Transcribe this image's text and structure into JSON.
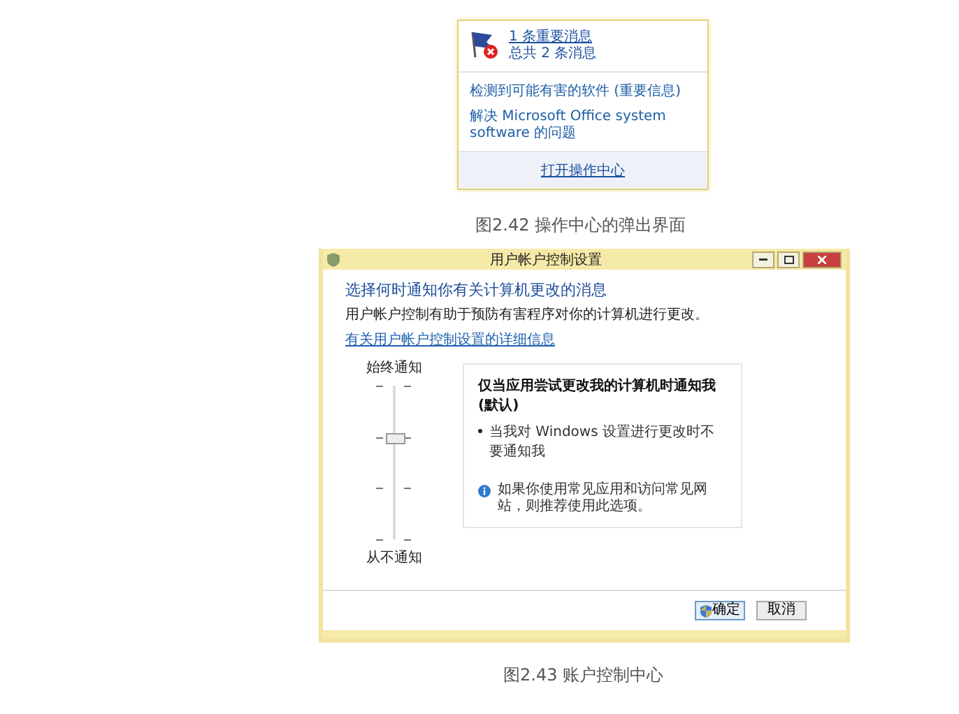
{
  "popup": {
    "header_title": "1 条重要消息",
    "header_subtitle": "总共 2 条消息",
    "links": [
      "检测到可能有害的软件 (重要信息)",
      "解决 Microsoft Office system software 的问题"
    ],
    "footer_link": "打开操作中心"
  },
  "caption_1": "图2.42 操作中心的弹出界面",
  "dialog": {
    "title": "用户帐户控制设置",
    "heading": "选择何时通知你有关计算机更改的消息",
    "description": "用户帐户控制有助于预防有害程序对你的计算机进行更改。",
    "help_link": "有关用户帐户控制设置的详细信息",
    "slider_top_label": "始终通知",
    "slider_bottom_label": "从不通知",
    "slider": {
      "level": 0.667
    },
    "panel_title": "仅当应用尝试更改我的计算机时通知我(默认)",
    "panel_bullets": [
      "当我对 Windows 设置进行更改时不要通知我"
    ],
    "panel_note": "如果你使用常见应用和访问常见网站，则推荐使用此选项。",
    "buttons": [
      {
        "label": "确定",
        "kind": "shield"
      },
      {
        "label": "取消",
        "kind": "plain"
      }
    ]
  },
  "caption_2": "图2.43 账户控制中心"
}
